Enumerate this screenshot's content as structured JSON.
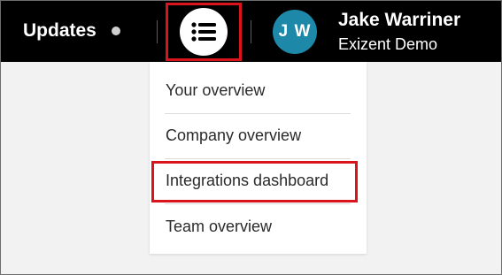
{
  "header": {
    "updates_label": "Updates",
    "menu_icon": "list-icon",
    "user": {
      "initials": "J W",
      "name": "Jake Warriner",
      "organization": "Exizent Demo",
      "avatar_color": "#1e88a9"
    }
  },
  "dropdown": {
    "items": [
      {
        "label": "Your overview"
      },
      {
        "label": "Company overview"
      },
      {
        "label": "Integrations dashboard"
      },
      {
        "label": "Team overview"
      }
    ]
  },
  "colors": {
    "topbar": "#000000",
    "highlight": "#d9141c",
    "background": "#f2f2f2"
  }
}
